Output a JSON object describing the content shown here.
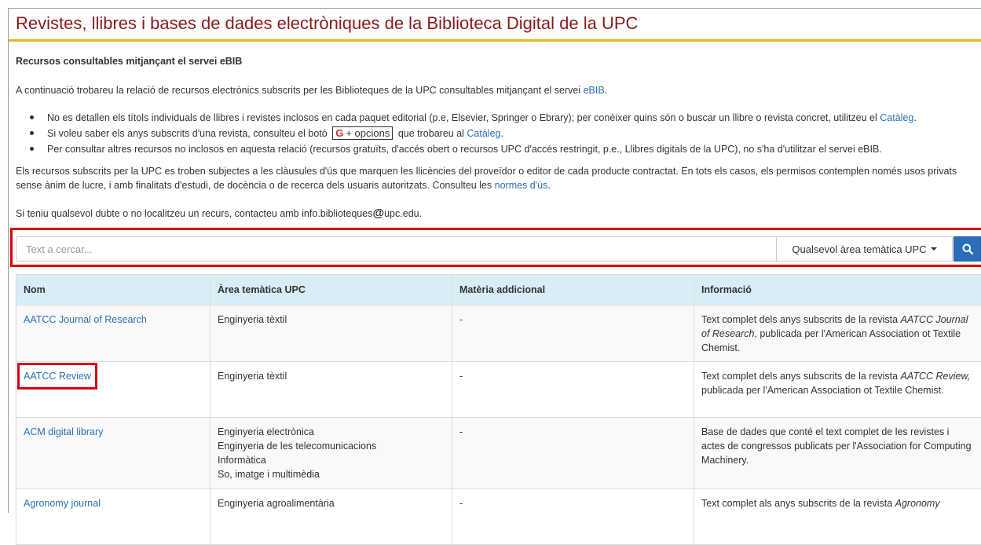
{
  "page": {
    "title": "Revistes, llibres i bases de dades electròniques de la Biblioteca Digital de la UPC",
    "subtitle": "Recursos consultables mitjançant el servei eBIB",
    "intro": {
      "text": "A continuació trobareu la relació de recursos electrònics subscrits per les Biblioteques de la UPC consultables mitjançant el servei ",
      "link": "eBIB",
      "end": "."
    },
    "bullets": {
      "b1_text": "No es detallen els títols individuals de llibres i revistes inclosos en cada paquet editorial (p.e, Elsevier, Springer o Ebrary); per conèixer quins són o buscar un llibre o revista concret, utilitzeu el ",
      "b1_link": "Catàleg",
      "b1_end": ".",
      "b2_text": "Si voleu saber els anys subscrits d'una revista, consulteu el botó ",
      "b2_button": "+ opcions",
      "b2_mid": " que trobareu al ",
      "b2_link": "Catàleg",
      "b2_end": ".",
      "b3_text": "Per consultar altres recursos no inclosos en aquesta relació (recursos gratuïts, d'accés obert o recursos UPC d'accés restringit, p.e., Llibres digitals de la UPC), no s'ha d'utilitzar el servei eBIB."
    },
    "licence": {
      "text": "Els recursos subscrits per la UPC es troben subjectes a les clàusules d'ús que marquen les llicències del proveïdor o editor de cada producte contractat. En tots els casos, els permisos contemplen només usos privats sense ànim de lucre, i amb finalitats d'estudi, de docència o de recerca dels usuaris autoritzats. Consulteu les ",
      "link": "normes d'ús",
      "end": "."
    },
    "contact": {
      "text": "Si teniu qualsevol dubte o no localitzeu un recurs, contacteu amb info.biblioteques",
      "at": "@",
      "domain": "upc.edu."
    }
  },
  "search": {
    "placeholder": "Text a cercar...",
    "value": "",
    "area_select": "Qualsevol àrea temàtica UPC",
    "button_icon": "search-icon"
  },
  "table": {
    "headers": [
      "Nom",
      "Àrea temàtica UPC",
      "Matèria addicional",
      "Informació"
    ],
    "rows": [
      {
        "name": "AATCC Journal of Research",
        "area": [
          "Enginyeria tèxtil"
        ],
        "extra": "-",
        "info_pre": "Text complet dels anys subscrits de la revista ",
        "info_em": "AATCC Journal of Research",
        "info_post": ", publicada per l'American Association ot Textile Chemist."
      },
      {
        "name": "AATCC Review",
        "area": [
          "Enginyeria tèxtil"
        ],
        "extra": "-",
        "info_pre": "Text complet dels anys subscrits de la revista ",
        "info_em": "AATCC Review,",
        "info_post": " publicada per l'American Association ot Textile Chemist."
      },
      {
        "name": "ACM digital library",
        "area": [
          "Enginyeria electrònica",
          "Enginyeria de les telecomunicacions",
          "Informàtica",
          "So, imatge i multimèdia"
        ],
        "extra": "-",
        "info_pre": "Base de dades que conté el text complet de les revistes i actes de congressos publicats per l'Association for Computing Machinery.",
        "info_em": "",
        "info_post": ""
      },
      {
        "name": "Agronomy journal",
        "area": [
          "Enginyeria agroalimentària"
        ],
        "extra": "-",
        "info_pre": "Text complet als anys subscrits de la revista ",
        "info_em": "Agronomy",
        "info_post": ""
      }
    ]
  },
  "colors": {
    "title": "#8b1a1a",
    "title_rule": "#e6b325",
    "link": "#2a6ebb",
    "header_bg": "#d9edf7",
    "highlight": "#d9000d"
  }
}
